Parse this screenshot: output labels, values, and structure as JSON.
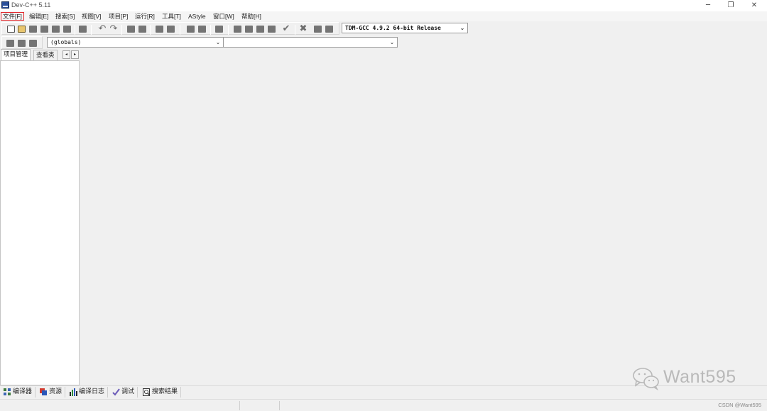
{
  "window": {
    "title": "Dev-C++ 5.11",
    "minimize_glyph": "─",
    "maximize_glyph": "❐",
    "close_glyph": "✕"
  },
  "menu": [
    {
      "label": "文件[F]",
      "active": true
    },
    {
      "label": "编辑[E]"
    },
    {
      "label": "搜索[S]"
    },
    {
      "label": "视图[V]"
    },
    {
      "label": "项目[P]"
    },
    {
      "label": "运行[R]"
    },
    {
      "label": "工具[T]"
    },
    {
      "label": "AStyle"
    },
    {
      "label": "窗口[W]"
    },
    {
      "label": "帮助[H]"
    }
  ],
  "toolbar": {
    "compiler_select": "TDM-GCC 4.9.2 64-bit Release",
    "undo_glyph": "↶",
    "redo_glyph": "↷",
    "check_glyph": "✔",
    "stop_glyph": "✖"
  },
  "class_toolbar": {
    "scope_select": "(globals)",
    "member_select": ""
  },
  "left_panel": {
    "tabs": [
      "项目管理",
      "查看类"
    ],
    "scroll_left": "◂",
    "scroll_right": "▸"
  },
  "bottom_tabs": [
    {
      "label": "编译器",
      "icon": "compiler-icon"
    },
    {
      "label": "资源",
      "icon": "resources-icon"
    },
    {
      "label": "编译日志",
      "icon": "compile-log-icon"
    },
    {
      "label": "调试",
      "icon": "debug-check-icon"
    },
    {
      "label": "搜索结果",
      "icon": "search-results-icon"
    }
  ],
  "statusbar": {
    "credit": "CSDN @Want595"
  },
  "watermark": {
    "text": "Want595"
  }
}
